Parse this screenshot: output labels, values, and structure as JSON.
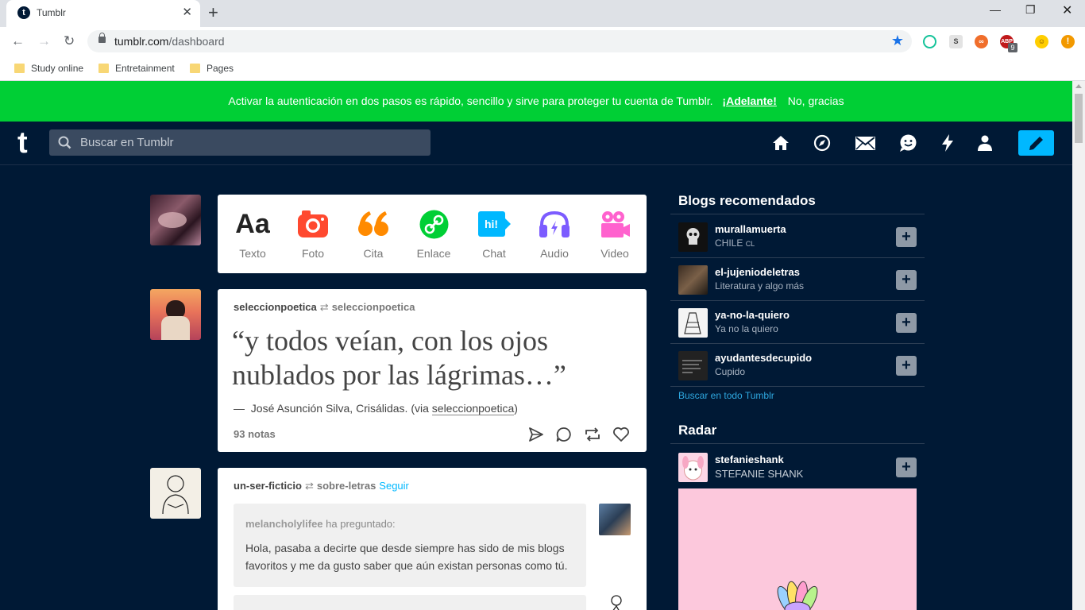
{
  "browser": {
    "tab_title": "Tumblr",
    "tab_favicon": "t",
    "url_host": "tumblr.com",
    "url_path": "/dashboard",
    "bookmarks": [
      "Study online",
      "Entretainment",
      "Pages"
    ],
    "extension_badge": "9"
  },
  "banner": {
    "text": "Activar la autenticación en dos pasos es rápido, sencillo y sirve para proteger tu cuenta de Tumblr.",
    "cta": "¡Adelante!",
    "dismiss": "No, gracias",
    "color": "#00cf35"
  },
  "header": {
    "logo": "t",
    "search_placeholder": "Buscar en Tumblr",
    "accent": "#00b8ff",
    "nav_icons": [
      "home-icon",
      "explore-icon",
      "inbox-icon",
      "messaging-icon",
      "activity-icon",
      "account-icon",
      "compose-pencil-icon"
    ]
  },
  "post_types": [
    {
      "label": "Texto",
      "glyph": "Aa",
      "color": "#222222"
    },
    {
      "label": "Foto",
      "color": "#ff492f"
    },
    {
      "label": "Cita",
      "color": "#ff8a00"
    },
    {
      "label": "Enlace",
      "color": "#00cf35"
    },
    {
      "label": "Chat",
      "glyph": "hi!",
      "color": "#00b8ff"
    },
    {
      "label": "Audio",
      "color": "#7c5cff"
    },
    {
      "label": "Video",
      "color": "#ff62ce"
    }
  ],
  "post1": {
    "blog": "seleccionpoetica",
    "reblogged_from": "seleccionpoetica",
    "quote": "“y todos veían, con los ojos nublados por las lágrimas…”",
    "source_dash": "—",
    "source_text": "José Asunción Silva, Crisálidas. (via",
    "source_via": "seleccionpoetica",
    "source_close": ")",
    "notes": "93 notas"
  },
  "post2": {
    "blog": "un-ser-ficticio",
    "reblogged_from": "sobre-letras",
    "follow": "Seguir",
    "asker": "melancholylifee",
    "asked_label": "ha preguntado:",
    "ask_text": "Hola, pasaba a decirte que desde siempre has sido de mis blogs favoritos y me da gusto saber que aún existan personas como tú."
  },
  "sidebar": {
    "recommended_title": "Blogs recomendados",
    "recommended": [
      {
        "name": "murallamuerta",
        "subtitle": "CHILE",
        "subtitle_small": "CL"
      },
      {
        "name": "el-jujeniodeletras",
        "subtitle": "Literatura y algo más"
      },
      {
        "name": "ya-no-la-quiero",
        "subtitle": "Ya no la quiero"
      },
      {
        "name": "ayudantesdecupido",
        "subtitle": "Cupido"
      }
    ],
    "explore_link": "Buscar en todo Tumblr",
    "radar_title": "Radar",
    "radar": {
      "name": "stefanieshank",
      "subtitle": "STEFANIE SHANK"
    },
    "plus": "+"
  }
}
